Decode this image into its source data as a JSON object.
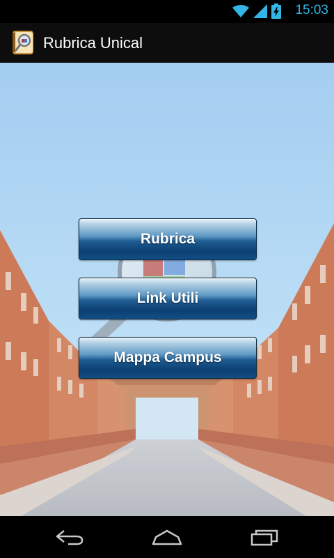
{
  "status_bar": {
    "time": "15:03",
    "icons": [
      "wifi-icon",
      "signal-icon",
      "battery-charging-icon"
    ],
    "accent_color": "#33b5e5"
  },
  "action_bar": {
    "title": "Rubrica Unical",
    "icon": "app-magnifier-book-icon"
  },
  "menu": {
    "buttons": [
      {
        "label": "Rubrica"
      },
      {
        "label": "Link Utili"
      },
      {
        "label": "Mappa Campus"
      }
    ]
  },
  "nav_bar": {
    "icons": [
      "back-icon",
      "home-icon",
      "recent-apps-icon"
    ]
  }
}
